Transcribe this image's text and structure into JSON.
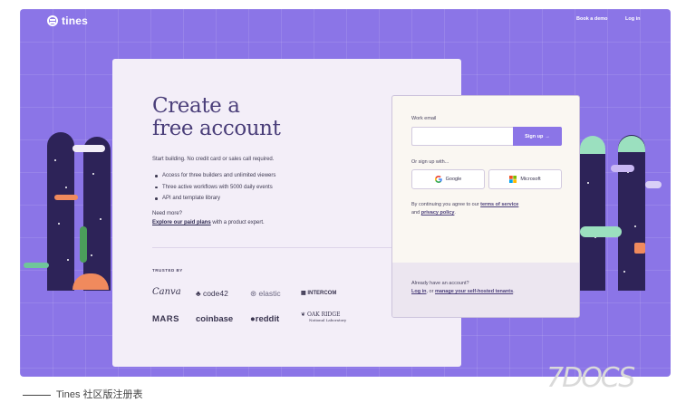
{
  "nav": {
    "logo_text": "tines",
    "book_demo": "Book a demo",
    "log_in": "Log in"
  },
  "hero": {
    "headline_line1": "Create a",
    "headline_line2": "free account",
    "subtext": "Start building. No credit card or sales call required.",
    "bullets": [
      "Access for three builders and unlimited viewers",
      "Three active workflows with 5000 daily events",
      "API and template library"
    ],
    "need_more": "Need more?",
    "paid_plans_link": "Explore our paid plans",
    "paid_plans_suffix": " with a product expert."
  },
  "trusted": {
    "label": "TRUSTED BY",
    "brands": [
      "Canva",
      "code42",
      "elastic",
      "INTERCOM",
      "MARS",
      "coinbase",
      "reddit",
      "OAK RIDGE"
    ],
    "oak_ridge_sub": "National Laboratory"
  },
  "form": {
    "email_label": "Work email",
    "email_value": "",
    "email_placeholder": "",
    "signup_label": "Sign up",
    "signup_arrow": "→",
    "or_label": "Or sign up with...",
    "google_label": "Google",
    "microsoft_label": "Microsoft",
    "terms_prefix": "By continuing you agree to our ",
    "terms_link": "terms of service",
    "terms_mid": " and ",
    "privacy_link": "privacy policy",
    "terms_end": ".",
    "already": "Already have an account?",
    "login_link": "Log in",
    "or_word": ", or ",
    "manage_link": "manage your self-hosted tenants",
    "foot_end": "."
  },
  "caption": "Tines 社区版注册表",
  "watermark": "7DOCS",
  "colors": {
    "background": "#8b75e7",
    "card": "#f3eef8",
    "form": "#faf7f2",
    "accent": "#8b75e7",
    "pillar": "#2d2358"
  }
}
